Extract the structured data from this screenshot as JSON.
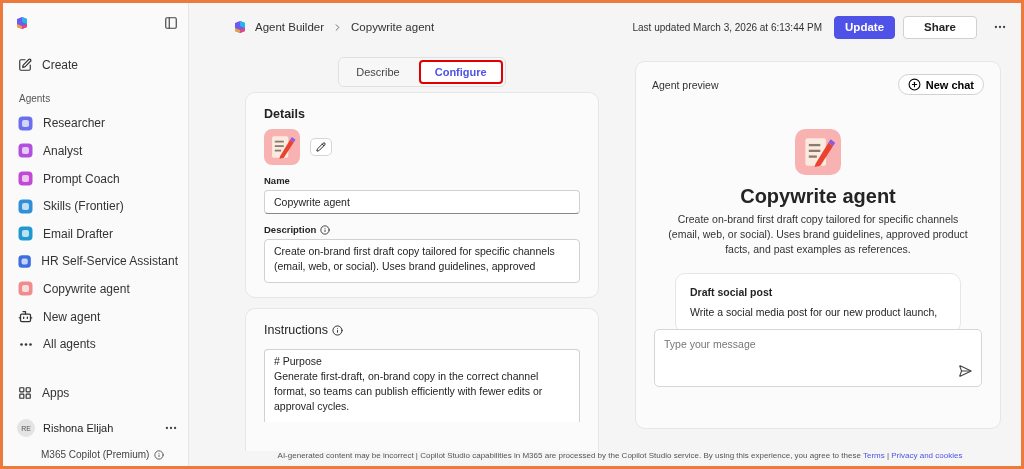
{
  "sidebar": {
    "create": "Create",
    "section": "Agents",
    "agents": [
      {
        "label": "Researcher"
      },
      {
        "label": "Analyst"
      },
      {
        "label": "Prompt Coach"
      },
      {
        "label": "Skills (Frontier)"
      },
      {
        "label": "Email Drafter"
      },
      {
        "label": "HR Self-Service Assistant"
      },
      {
        "label": "Copywrite agent"
      },
      {
        "label": "New agent"
      },
      {
        "label": "All agents"
      }
    ],
    "apps": "Apps",
    "user": {
      "initials": "RE",
      "name": "Rishona Elijah"
    },
    "plan": "M365 Copilot (Premium)"
  },
  "header": {
    "breadcrumb": [
      "Agent Builder",
      "Copywrite agent"
    ],
    "last_updated": "Last updated March 3, 2026 at 6:13:44 PM",
    "update": "Update",
    "share": "Share"
  },
  "tabs": [
    {
      "label": "Describe",
      "selected": false,
      "highlighted": false
    },
    {
      "label": "Configure",
      "selected": true,
      "highlighted": true
    }
  ],
  "details": {
    "title": "Details",
    "name_label": "Name",
    "name_value": "Copywrite agent",
    "description_label": "Description",
    "description_lines": [
      "Create on-brand first draft copy tailored for specific channels",
      "(email, web, or social). Uses brand guidelines, approved"
    ]
  },
  "instructions": {
    "title": "Instructions",
    "lines": [
      "# Purpose",
      "Generate first-draft, on-brand copy in the correct channel format, so teams can publish efficiently with fewer edits or approval cycles."
    ]
  },
  "preview": {
    "title": "Agent preview",
    "new_chat": "New chat",
    "agent_name": "Copywrite agent",
    "agent_description": "Create on-brand first draft copy tailored for specific channels (email, web, or social). Uses brand guidelines, approved product facts, and past examples as references.",
    "starter": {
      "title": "Draft social post",
      "text": "Write a social media post for our new product launch,"
    },
    "placeholder": "Type your message"
  },
  "footer": {
    "text": "AI-generated content may be incorrect | Copilot Studio capabilities in M365 are processed by the Copilot Studio service. By using this experience, you agree to these",
    "links": [
      "Terms",
      "Privacy and cookies"
    ],
    "separator": "|"
  }
}
